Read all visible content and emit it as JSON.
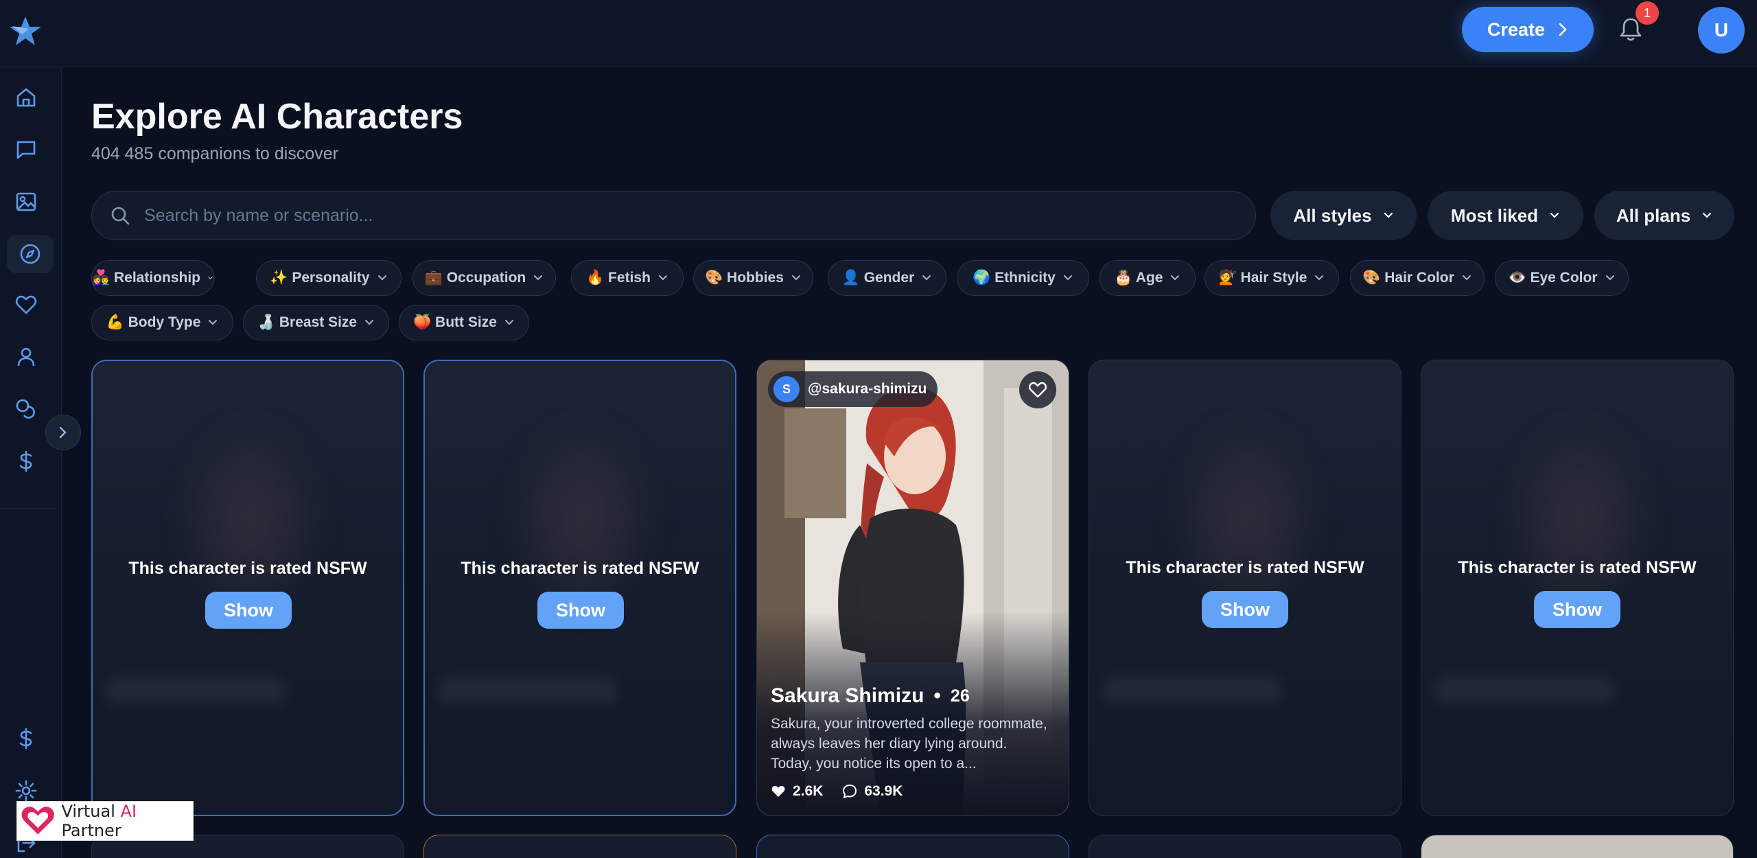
{
  "header": {
    "create_label": "Create",
    "notification_count": "1",
    "avatar_initial": "U",
    "brand_color": "#3b82f6"
  },
  "sidebar": {
    "items": [
      {
        "icon": "home-icon"
      },
      {
        "icon": "chat-icon"
      },
      {
        "icon": "image-icon"
      },
      {
        "icon": "compass-icon",
        "active": true
      },
      {
        "icon": "heart-icon"
      },
      {
        "icon": "user-icon"
      },
      {
        "icon": "coins-icon"
      },
      {
        "icon": "dollar-icon"
      }
    ],
    "bottom_items": [
      {
        "icon": "dollar-icon"
      },
      {
        "icon": "gear-icon"
      },
      {
        "icon": "logout-icon"
      }
    ],
    "partner_badge": {
      "text_before": "Virtual ",
      "text_ai": "AI",
      "text_after": " Partner"
    }
  },
  "main": {
    "title": "Explore AI Characters",
    "subtitle": "404 485 companions to discover",
    "search": {
      "placeholder": "Search by name or scenario..."
    },
    "dropdowns": {
      "styles": "All styles",
      "sort": "Most liked",
      "plans": "All plans"
    },
    "filters": [
      "👩‍❤️‍👨 Relationship",
      "✨ Personality",
      "💼 Occupation",
      "🔥 Fetish",
      "🎨 Hobbies",
      "👤 Gender",
      "🌍 Ethnicity",
      "🎂 Age",
      "💇 Hair Style",
      "🎨 Hair Color",
      "👁️ Eye Color",
      "💪 Body Type",
      "🍶 Breast Size",
      "🍑 Butt Size"
    ],
    "nsfw_text": "This character is rated NSFW",
    "show_label": "Show",
    "featured": {
      "handle": "@sakura-shimizu",
      "handle_initial": "S",
      "name": "Sakura Shimizu",
      "separator": "•",
      "age": "26",
      "description": "Sakura, your introverted college roommate, always leaves her diary lying around. Today, you notice its open to a...",
      "likes": "2.6K",
      "messages": "63.9K"
    }
  }
}
